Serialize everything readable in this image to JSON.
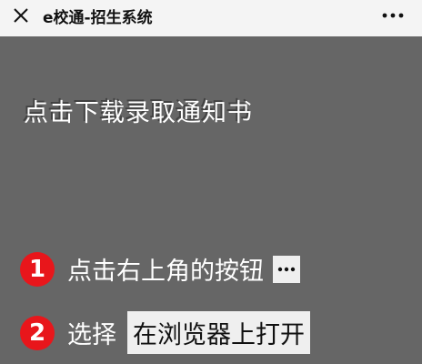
{
  "titlebar": {
    "title": "e校通-招生系统",
    "close_icon": "close-icon",
    "more_icon": "more-horizontal-icon"
  },
  "content": {
    "download_text": "点击下载录取通知书",
    "steps": [
      {
        "number": "1",
        "text": "点击右上角的按钮",
        "chip_icon": "more-horizontal-icon"
      },
      {
        "number": "2",
        "text": "选择",
        "chip_label": "在浏览器上打开"
      }
    ]
  },
  "colors": {
    "overlay": "#666666",
    "titlebar": "#f4f4f4",
    "step_badge": "#e8161b",
    "chip": "#efefef"
  }
}
